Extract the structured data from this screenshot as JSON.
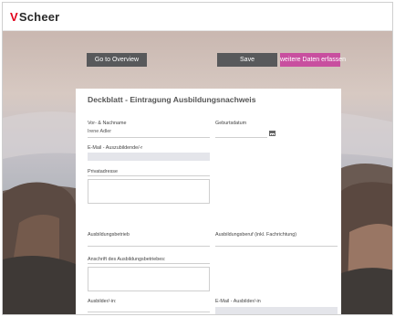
{
  "brand": {
    "mark": "V",
    "name": "Scheer"
  },
  "toolbar": {
    "overview_label": "Go to Overview",
    "save_label": "Save",
    "more_label": "weitere Daten erfassen"
  },
  "form": {
    "title": "Deckblatt - Eintragung Ausbildungsnachweis",
    "name_label": "Vor- & Nachname",
    "name_value": "Irene Adler",
    "birth_label": "Geburtsdatum",
    "email_label": "E-Mail - Auszubildende/-r",
    "address_label": "Privatadresse",
    "company_label": "Ausbildungsbetrieb",
    "profession_label": "Ausbildungsberuf (inkl. Fachrichtung)",
    "company_address_label": "Anschrift des Ausbildungsbetriebes:",
    "trainer_label": "Ausbilder/-in:",
    "trainer_email_label": "E-Mail - Ausbilder/-in"
  },
  "colors": {
    "accent": "#c84f9f",
    "dark_button": "#58595b",
    "field_bg": "#e4e5ea",
    "brand_red": "#e2001a"
  }
}
